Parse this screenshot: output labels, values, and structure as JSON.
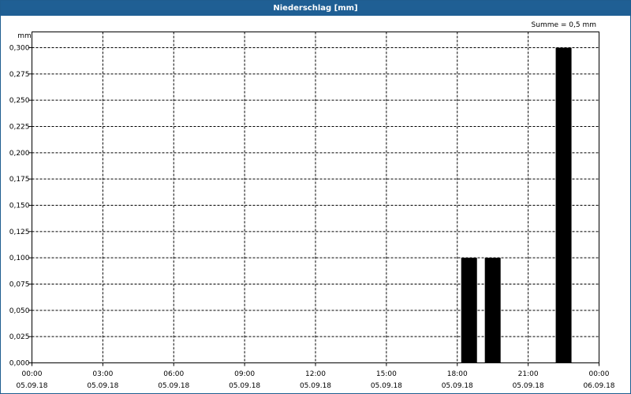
{
  "window": {
    "title": "Niederschlag [mm]"
  },
  "summary": "Summe = 0,5 mm",
  "chart_data": {
    "type": "bar",
    "ylabel": "mm",
    "ylim": [
      0,
      0.3
    ],
    "y_ticks": [
      "0,000",
      "0,025",
      "0,050",
      "0,075",
      "0,100",
      "0,125",
      "0,150",
      "0,175",
      "0,200",
      "0,225",
      "0,250",
      "0,275",
      "0,300"
    ],
    "xlim_hours": [
      0,
      24
    ],
    "x_ticks": [
      {
        "time": "00:00",
        "date": "05.09.18"
      },
      {
        "time": "03:00",
        "date": "05.09.18"
      },
      {
        "time": "06:00",
        "date": "05.09.18"
      },
      {
        "time": "09:00",
        "date": "05.09.18"
      },
      {
        "time": "12:00",
        "date": "05.09.18"
      },
      {
        "time": "15:00",
        "date": "05.09.18"
      },
      {
        "time": "18:00",
        "date": "05.09.18"
      },
      {
        "time": "21:00",
        "date": "05.09.18"
      },
      {
        "time": "00:00",
        "date": "06.09.18"
      }
    ],
    "bars": [
      {
        "time": "18:30",
        "value": 0.1
      },
      {
        "time": "19:30",
        "value": 0.1
      },
      {
        "time": "22:30",
        "value": 0.3
      }
    ],
    "bar_color": "#000000",
    "grid": true
  }
}
